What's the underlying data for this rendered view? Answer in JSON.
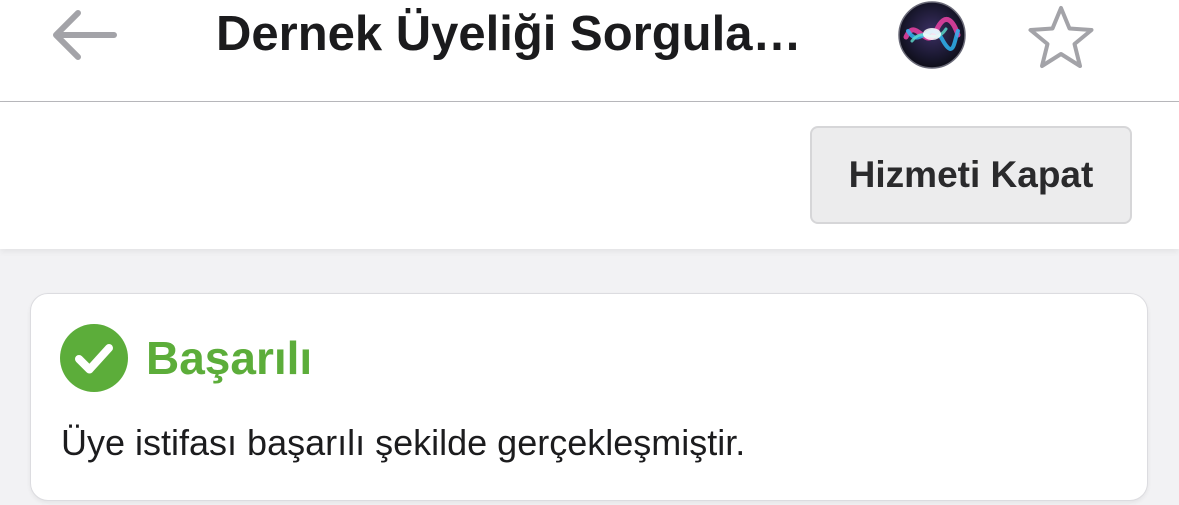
{
  "header": {
    "back_icon": "arrow-left-icon",
    "title": "Dernek Üyeliği Sorgula…",
    "assistant_icon": "siri-icon",
    "favorite_icon": "star-outline-icon"
  },
  "actions": {
    "close_service_label": "Hizmeti Kapat"
  },
  "result": {
    "status_icon": "check-circle-icon",
    "title": "Başarılı",
    "message": "Üye istifası başarılı şekilde gerçekleşmiştir."
  },
  "colors": {
    "success": "#5cad3a",
    "icon_gray": "#a3a3a8",
    "text": "#1b1b1d"
  }
}
